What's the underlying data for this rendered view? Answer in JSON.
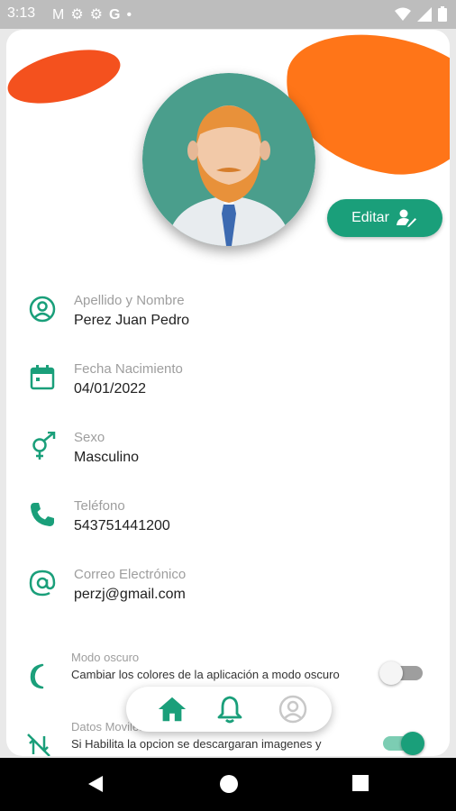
{
  "status_bar": {
    "time": "3:13",
    "icons": [
      "gmail-icon",
      "settings-icon",
      "settings-icon",
      "google-icon",
      "dot-icon"
    ],
    "right_icons": [
      "wifi-icon",
      "signal-icon",
      "battery-icon"
    ]
  },
  "profile": {
    "edit_label": "Editar",
    "fields": [
      {
        "label": "Apellido y Nombre",
        "value": "Perez Juan Pedro",
        "icon": "account-circle-icon"
      },
      {
        "label": "Fecha Nacimiento",
        "value": "04/01/2022",
        "icon": "calendar-icon"
      },
      {
        "label": "Sexo",
        "value": "Masculino",
        "icon": "gender-icon"
      },
      {
        "label": "Teléfono",
        "value": "543751441200",
        "icon": "phone-icon"
      },
      {
        "label": "Correo Electrónico",
        "value": "perzj@gmail.com",
        "icon": "at-icon"
      }
    ]
  },
  "settings": [
    {
      "title": "Modo oscuro",
      "description": "Cambiar los colores de la aplicación a modo oscuro",
      "enabled": false,
      "icon": "moon-icon"
    },
    {
      "title": "Datos Moviles",
      "description": "Si Habilita la opcion se descargaran imagenes y",
      "enabled": true,
      "icon": "mobile-data-off-icon"
    }
  ],
  "bottom_nav": {
    "items": [
      "home-icon",
      "bell-icon",
      "account-icon"
    ],
    "active": "home-icon"
  },
  "colors": {
    "accent": "#1a9f7a",
    "orange": "#ff7518",
    "red_orange": "#f4511e"
  }
}
